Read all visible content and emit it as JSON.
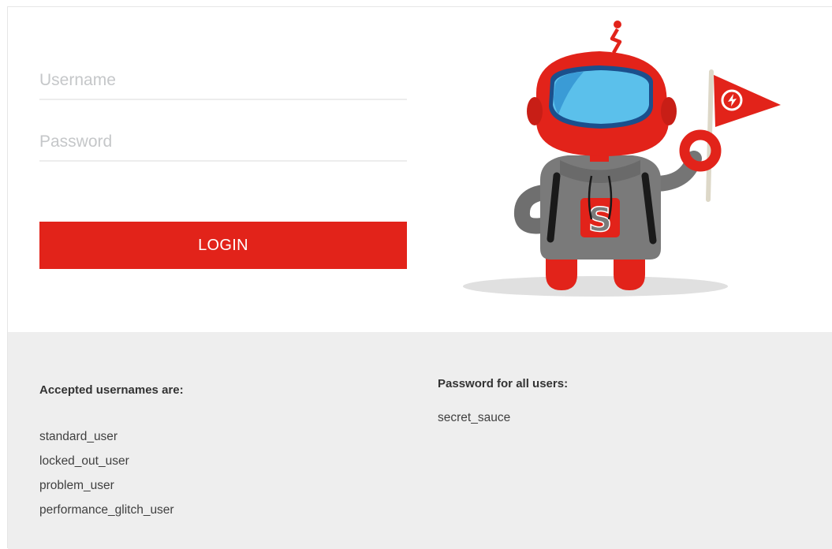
{
  "login": {
    "username_placeholder": "Username",
    "password_placeholder": "Password",
    "login_label": "LOGIN"
  },
  "mascot": {
    "icon": "robot-mascot-icon",
    "shirt_letter": "S"
  },
  "credentials": {
    "usernames_heading": "Accepted usernames are:",
    "usernames": [
      "standard_user",
      "locked_out_user",
      "problem_user",
      "performance_glitch_user"
    ],
    "password_heading": "Password for all users:",
    "password": "secret_sauce"
  },
  "colors": {
    "accent": "#e2231a",
    "panel_bg": "#eeeeee",
    "input_border": "#ededed",
    "placeholder": "#c5c7c9",
    "text": "#333333"
  }
}
